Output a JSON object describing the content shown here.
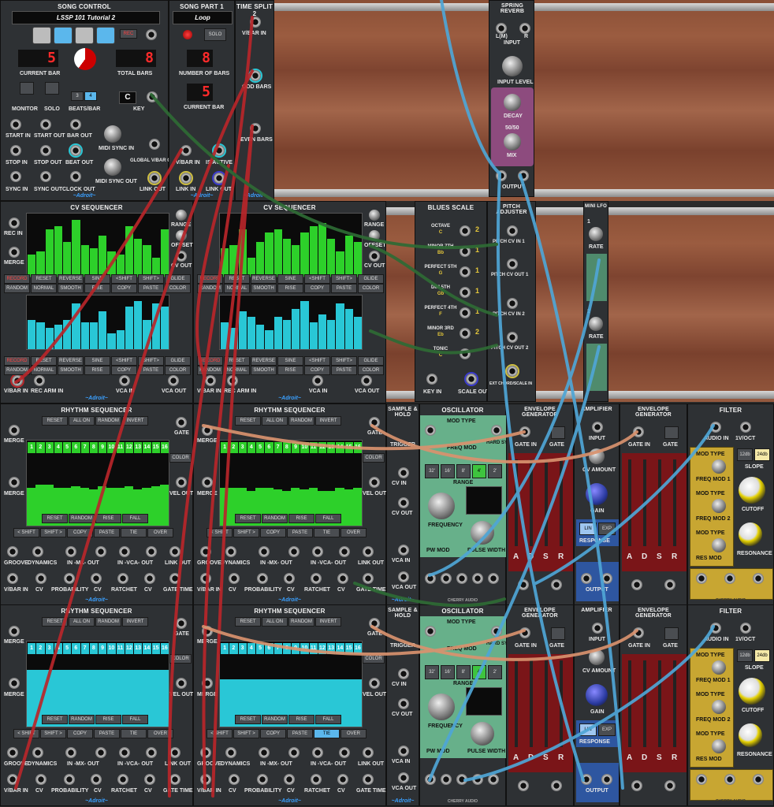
{
  "song_control": {
    "title": "SONG CONTROL",
    "song_name": "LSSP 101 Tutorial 2",
    "rec_label": "REC",
    "current_bar_value": "5",
    "current_bar_label": "CURRENT BAR",
    "total_bars_value": "8",
    "total_bars_label": "TOTAL BARS",
    "monitor_label": "MONITOR",
    "solo_label": "SOLO",
    "beats_bar_label": "BEATS/BAR",
    "beats_option_1": "3",
    "beats_option_2": "4",
    "key_label": "KEY",
    "key_value": "C",
    "start_in": "START IN",
    "start_out": "START OUT",
    "bar_out": "BAR OUT",
    "midi_sync_in": "MIDI SYNC IN",
    "stop_in": "STOP IN",
    "stop_out": "STOP OUT",
    "beat_out": "BEAT OUT",
    "global_vbar_out": "GLOBAL V/BAR OUT",
    "midi_sync_out": "MIDI SYNC OUT",
    "sync_in": "SYNC IN",
    "sync_out": "SYNC OUT",
    "clock_out": "CLOCK OUT",
    "link_out": "LINK OUT",
    "brand": "~Adroit~"
  },
  "song_part": {
    "title": "SONG PART 1",
    "part_name": "Loop",
    "solo_label": "SOLO",
    "number_of_bars_value": "8",
    "number_of_bars_label": "NUMBER OF BARS",
    "current_bar_value": "5",
    "current_bar_label": "CURRENT BAR",
    "v_bar_in": "V/BAR IN",
    "is_active": "IS ACTIVE",
    "link_in": "LINK IN",
    "link_out": "LINK OUT",
    "brand": "~Adroit~"
  },
  "time_split": {
    "title": "TIME SPLIT 2",
    "v_bar_in": "V/BAR IN",
    "odd_bars": "ODD BARS",
    "even_bars": "EVEN BARS",
    "brand": "~Adroit~"
  },
  "spring_reverb": {
    "title": "SPRING REVERB",
    "input_l": "L(M)",
    "input_r": "R",
    "input_label": "INPUT",
    "input_level": "INPUT LEVEL",
    "short": "SHORT",
    "long": "LONG",
    "decay": "DECAY",
    "mix_ratio": "50/50",
    "dry": "DRY",
    "wet": "WET",
    "mix": "MIX",
    "output_l": "L",
    "output_r": "R",
    "output_label": "OUTPUT",
    "brand": "CHERRY AUDIO"
  },
  "cv_sequencer": {
    "title": "CV SEQUENCER",
    "rec_in": "REC IN",
    "merge": "MERGE",
    "range": "RANGE",
    "offset": "OFFSET",
    "cv_out": "CV OUT",
    "buttons_row1": [
      "RECORD",
      "RESET",
      "REVERSE",
      "SINE",
      "<SHIFT",
      "SHIFT>",
      "GLIDE"
    ],
    "buttons_row2": [
      "RANDOM",
      "NORMAL",
      "SMOOTH",
      "RISE",
      "COPY",
      "PASTE",
      "COLOR"
    ],
    "v_bar_in": "V/BAR IN",
    "rec_arm_in": "REC ARM IN",
    "vca_in": "VCA IN",
    "vca_out": "VCA OUT",
    "brand": "~Adroit~",
    "left_green_steps": [
      0.35,
      0.4,
      0.75,
      0.8,
      0.55,
      0.9,
      0.5,
      0.45,
      0.65,
      0.4,
      0.35,
      0.8,
      0.6,
      0.5,
      0.3,
      0.75
    ],
    "left_cyan_steps": [
      0.55,
      0.5,
      0.4,
      0.45,
      0.55,
      0.85,
      0.5,
      0.5,
      0.7,
      0.3,
      0.35,
      0.8,
      0.9,
      0.55,
      0.85,
      0.8
    ],
    "right_green_steps": [
      0.45,
      0.5,
      0.75,
      0.3,
      0.55,
      0.7,
      0.75,
      0.6,
      0.5,
      0.7,
      0.8,
      0.85,
      0.6,
      0.4,
      0.65,
      0.55
    ],
    "right_cyan_steps": [
      0.5,
      0.4,
      0.7,
      0.6,
      0.45,
      0.35,
      0.6,
      0.55,
      0.75,
      0.9,
      0.5,
      0.65,
      0.55,
      0.85,
      0.75,
      0.6
    ]
  },
  "blues_scale": {
    "title": "BLUES SCALE",
    "notes": [
      {
        "name": "OCTAVE",
        "note": "C",
        "index": "2"
      },
      {
        "name": "MINOR 7TH",
        "note": "Bb",
        "index": "1"
      },
      {
        "name": "PERFECT 5TH",
        "note": "G",
        "index": "1"
      },
      {
        "name": "DIM 5TH",
        "note": "Gb",
        "index": "1"
      },
      {
        "name": "PERFECT 4TH",
        "note": "F",
        "index": "1"
      },
      {
        "name": "MINOR 3RD",
        "note": "Eb",
        "index": "2"
      },
      {
        "name": "TONIC",
        "note": "C",
        "index": ""
      }
    ],
    "key_in": "KEY IN",
    "scale_out": "SCALE OUT"
  },
  "pitch_adjuster": {
    "title": "PITCH ADJUSTER",
    "pitch_cv_in_1": "PITCH CV IN 1",
    "pitch_cv_out_1": "PITCH CV OUT 1",
    "pitch_cv_in_2": "PITCH CV IN 2",
    "pitch_cv_out_2": "PITCH CV OUT 2",
    "ext_scale_in": "EXT CHORD/SCALE IN"
  },
  "mini_lfo": {
    "title": "MINI LFO",
    "ch1": "1",
    "ch2": "2",
    "rate": "RATE"
  },
  "rhythm_sequencer": {
    "title": "RHYTHM SEQUENCER",
    "top_buttons": [
      "RESET",
      "ALL ON",
      "RANDOM",
      "INVERT"
    ],
    "merge": "MERGE",
    "gate": "GATE",
    "color": "COLOR",
    "vel_out": "VEL OUT",
    "step_numbers": [
      "1",
      "2",
      "3",
      "4",
      "5",
      "6",
      "7",
      "8",
      "9",
      "10",
      "11",
      "12",
      "13",
      "14",
      "15",
      "16"
    ],
    "mid_buttons": [
      "RESET",
      "RANDOM",
      "RISE",
      "FALL"
    ],
    "bottom_buttons": [
      "< SHIFT",
      "SHIFT >",
      "COPY",
      "PASTE",
      "TIE",
      "OVER"
    ],
    "groove": "GROOVE",
    "dynamics": "DYNAMICS",
    "in_mx_out": "IN -MX- OUT",
    "in_vca_out": "IN -VCA- OUT",
    "link_out": "LINK OUT",
    "v_bar_in": "V/BAR IN",
    "cv": "CV",
    "probability": "PROBABILITY",
    "ratchet": "RATCHET",
    "gate_time": "GATE TIME",
    "brand": "~Adroit~",
    "row1_left_vel": [
      0.6,
      0.65,
      0.65,
      0.6,
      0.6,
      0.62,
      0.6,
      0.58,
      0.62,
      0.6,
      0.6,
      0.62,
      0.58,
      0.6,
      0.62,
      0.65
    ],
    "row1_right_vel": [
      0.6,
      0.6,
      0.6,
      0.55,
      0.6,
      0.6,
      0.58,
      0.55,
      0.6,
      0.58,
      0.6,
      0.55,
      0.55,
      0.6,
      0.58,
      0.6
    ],
    "row2_left_vel": [
      0.9,
      0.9,
      0.9,
      0.9,
      0.9,
      0.9,
      0.9,
      0.9,
      0.9,
      0.9,
      0.9,
      0.9,
      0.9,
      0.9,
      0.9,
      0.9
    ],
    "row2_right_vel": [
      0.75,
      0.75,
      0.75,
      0.75,
      0.75,
      0.75,
      0.75,
      0.75,
      0.75,
      0.75,
      0.75,
      0.75,
      0.75,
      0.75,
      0.75,
      0.75
    ]
  },
  "sample_hold": {
    "title": "SAMPLE & HOLD",
    "trigger": "TRIGGER",
    "cv_in": "CV IN",
    "cv_out": "CV OUT",
    "vca_in": "VCA IN",
    "vca_out": "VCA OUT",
    "brand": "~Adroit~"
  },
  "oscillator": {
    "title": "OSCILLATOR",
    "pitch": "PITCH",
    "mod_type": "MOD TYPE",
    "freq_mod": "FREQ MOD",
    "hard_sync": "HARD SYNC",
    "range_values": [
      "32'",
      "16'",
      "8'",
      "4'",
      "2'"
    ],
    "range_label": "RANGE",
    "frequency": "FREQUENCY",
    "freq_min": "-7",
    "freq_mid": "0",
    "freq_max": "+7",
    "pw_mod": "PW MOD",
    "pulse_width": "PULSE WIDTH",
    "brand": "CHERRY AUDIO"
  },
  "envelope_generator": {
    "title": "ENVELOPE GENERATOR",
    "gate_in": "GATE IN",
    "gate": "GATE",
    "sliders": [
      "A",
      "D",
      "S",
      "R"
    ]
  },
  "amplifier": {
    "title": "AMPLIFIER",
    "input": "INPUT",
    "cv_amount": "CV AMOUNT",
    "gain": "GAIN",
    "lin": "LIN",
    "exp": "EXP",
    "response": "RESPONSE",
    "output": "OUTPUT"
  },
  "filter": {
    "title": "FILTER",
    "audio_in": "AUDIO IN",
    "one_v_oct": "1V/OCT",
    "mod_type": "MOD TYPE",
    "freq_mod_1": "FREQ MOD 1",
    "freq_mod_2": "FREQ MOD 2",
    "res_mod": "RES MOD",
    "slope": "SLOPE",
    "slope_12": "12db",
    "slope_24": "24db",
    "cutoff": "CUTOFF",
    "resonance": "RESONANCE",
    "brand": "CHERRY AUDIO"
  },
  "colors": {
    "green": "#2dd02a",
    "cyan": "#29c7d6",
    "red_display": "#ff2a2a",
    "cable_red": "#b8262a",
    "cable_blue": "#4fa6d6",
    "cable_green": "#2e6b35",
    "cable_orange": "#d9926e",
    "filter_yellow": "#c8a632",
    "envelope_red": "#7a1518"
  }
}
